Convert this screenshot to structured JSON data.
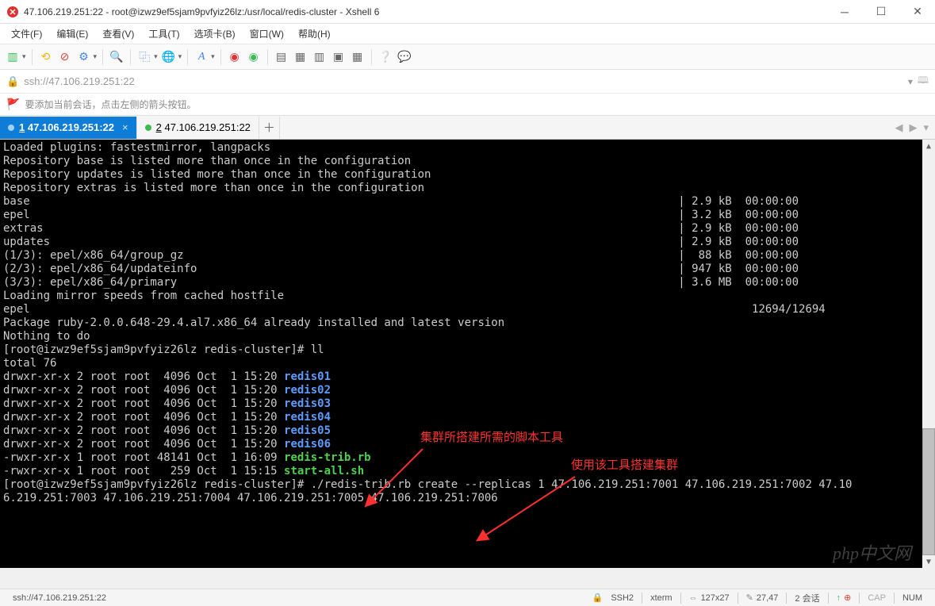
{
  "window": {
    "title": "47.106.219.251:22 - root@izwz9ef5sjam9pvfyiz26lz:/usr/local/redis-cluster - Xshell 6"
  },
  "menu": {
    "file": "文件(F)",
    "edit": "编辑(E)",
    "view": "查看(V)",
    "tools": "工具(T)",
    "tab": "选项卡(B)",
    "window": "窗口(W)",
    "help": "帮助(H)"
  },
  "address": {
    "url": "ssh://47.106.219.251:22"
  },
  "hint": {
    "text": "要添加当前会话，点击左侧的箭头按钮。"
  },
  "tabs": [
    {
      "num": "1",
      "label": "47.106.219.251:22",
      "active": true
    },
    {
      "num": "2",
      "label": "47.106.219.251:22",
      "active": false
    }
  ],
  "annotations": {
    "a1": "集群所搭建所需的脚本工具",
    "a2": "使用该工具搭建集群"
  },
  "terminal": {
    "lines": [
      "Loaded plugins: fastestmirror, langpacks",
      "Repository base is listed more than once in the configuration",
      "Repository updates is listed more than once in the configuration",
      "Repository extras is listed more than once in the configuration",
      "base                                                                                                 | 2.9 kB  00:00:00",
      "epel                                                                                                 | 3.2 kB  00:00:00",
      "extras                                                                                               | 2.9 kB  00:00:00",
      "updates                                                                                              | 2.9 kB  00:00:00",
      "(1/3): epel/x86_64/group_gz                                                                          |  88 kB  00:00:00",
      "(2/3): epel/x86_64/updateinfo                                                                        | 947 kB  00:00:00",
      "(3/3): epel/x86_64/primary                                                                           | 3.6 MB  00:00:00",
      "Loading mirror speeds from cached hostfile",
      "epel                                                                                                            12694/12694",
      "Package ruby-2.0.0.648-29.4.al7.x86_64 already installed and latest version",
      "Nothing to do"
    ],
    "prompt1_pre": "[root@izwz9ef5sjam9pvfyiz26lz redis-cluster]# ",
    "prompt1_cmd": "ll",
    "total": "total 76",
    "ls": [
      {
        "meta": "drwxr-xr-x 2 root root  4096 Oct  1 15:20 ",
        "name": "redis01",
        "cls": "c-bl"
      },
      {
        "meta": "drwxr-xr-x 2 root root  4096 Oct  1 15:20 ",
        "name": "redis02",
        "cls": "c-bl"
      },
      {
        "meta": "drwxr-xr-x 2 root root  4096 Oct  1 15:20 ",
        "name": "redis03",
        "cls": "c-bl"
      },
      {
        "meta": "drwxr-xr-x 2 root root  4096 Oct  1 15:20 ",
        "name": "redis04",
        "cls": "c-bl"
      },
      {
        "meta": "drwxr-xr-x 2 root root  4096 Oct  1 15:20 ",
        "name": "redis05",
        "cls": "c-bl"
      },
      {
        "meta": "drwxr-xr-x 2 root root  4096 Oct  1 15:20 ",
        "name": "redis06",
        "cls": "c-bl"
      },
      {
        "meta": "-rwxr-xr-x 1 root root 48141 Oct  1 16:09 ",
        "name": "redis-trib.rb",
        "cls": "c-gr"
      },
      {
        "meta": "-rwxr-xr-x 1 root root   259 Oct  1 15:15 ",
        "name": "start-all.sh",
        "cls": "c-gr"
      }
    ],
    "prompt2_pre": "[root@izwz9ef5sjam9pvfyiz26lz redis-cluster]# ",
    "prompt2_cmd": "./redis-trib.rb create --replicas 1 47.106.219.251:7001 47.106.219.251:7002 47.10",
    "prompt2_cont": "6.219.251:7003 47.106.219.251:7004 47.106.219.251:7005 47.106.219.251:7006"
  },
  "status": {
    "left": "ssh://47.106.219.251:22",
    "ssh": "SSH2",
    "term": "xterm",
    "size": "127x27",
    "pos": "27,47",
    "sess": "2 会话",
    "cap": "CAP",
    "num": "NUM",
    "up": "↑",
    "plus": "⊕"
  },
  "watermark": "php中文网"
}
